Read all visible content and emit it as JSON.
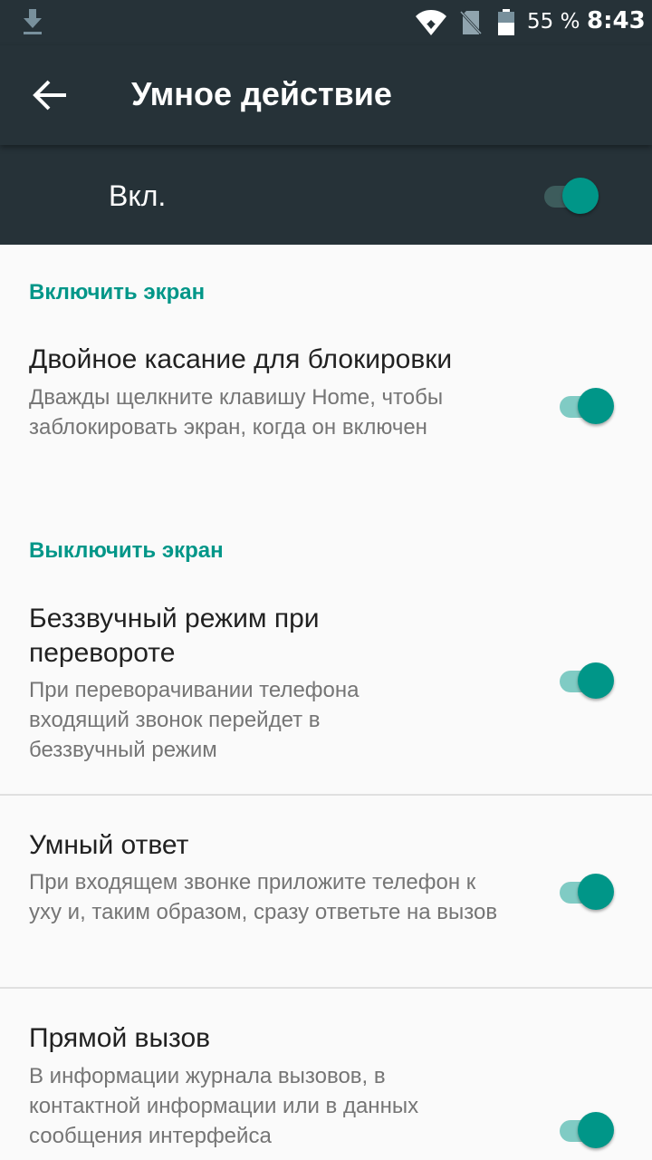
{
  "status": {
    "battery": "55 %",
    "time": "8:43"
  },
  "appbar": {
    "title": "Умное действие"
  },
  "master": {
    "label": "Вкл.",
    "enabled": true
  },
  "sections": [
    {
      "header": "Включить экран"
    },
    {
      "header": "Выключить экран"
    }
  ],
  "items": [
    {
      "title": "Двойное касание для блокировки",
      "desc": "Дважды щелкните клавишу Home, чтобы заблокировать экран, когда он включен",
      "enabled": true
    },
    {
      "title": "Беззвучный режим при перевороте",
      "desc": "При переворачивании телефона входящий звонок перейдет в беззвучный режим",
      "enabled": true
    },
    {
      "title": "Умный ответ",
      "desc": "При входящем звонке приложите телефон к уху и, таким образом, сразу ответьте на вызов",
      "enabled": true
    },
    {
      "title": "Прямой вызов",
      "desc": "В информации журнала вызовов, в контактной информации или в данных сообщения интерфейса",
      "enabled": true
    }
  ],
  "colors": {
    "accent": "#009688",
    "toolbar": "#263238",
    "background": "#fafafa"
  },
  "icons": [
    "download-icon",
    "wifi-icon",
    "no-sim-icon",
    "battery-icon",
    "back-arrow-icon"
  ]
}
